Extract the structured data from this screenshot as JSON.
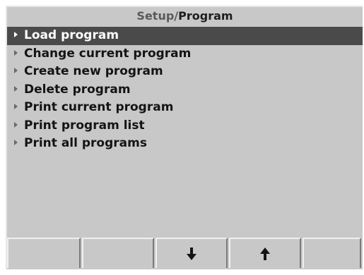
{
  "header": {
    "parent": "Setup",
    "separator": "/",
    "current": "Program"
  },
  "menu": {
    "selected_index": 0,
    "items": [
      {
        "label": "Load program"
      },
      {
        "label": "Change current program"
      },
      {
        "label": "Create new program"
      },
      {
        "label": "Delete program"
      },
      {
        "label": "Print current program"
      },
      {
        "label": "Print program list"
      },
      {
        "label": "Print all programs"
      }
    ]
  },
  "softkeys": [
    {
      "icon": ""
    },
    {
      "icon": ""
    },
    {
      "icon": "arrow-down-icon"
    },
    {
      "icon": "arrow-up-icon"
    },
    {
      "icon": ""
    }
  ],
  "colors": {
    "background": "#c8c8c8",
    "selection": "#4a4a4a",
    "text": "#141414"
  }
}
